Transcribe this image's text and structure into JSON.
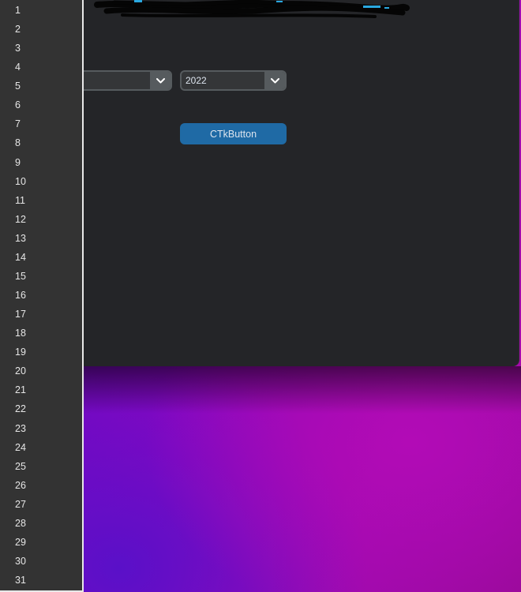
{
  "window": {
    "background_color": "#242528",
    "title_redacted": true
  },
  "comboboxes": [
    {
      "id": "combo-left",
      "value": "",
      "icon": "chevron-down-icon"
    },
    {
      "id": "combo-year",
      "value": "2022",
      "icon": "chevron-down-icon"
    }
  ],
  "button": {
    "label": "CTkButton",
    "color": "#1f6aa5"
  },
  "dropdown": {
    "options": [
      "1",
      "2",
      "3",
      "4",
      "5",
      "6",
      "7",
      "8",
      "9",
      "10",
      "11",
      "12",
      "13",
      "14",
      "15",
      "16",
      "17",
      "18",
      "19",
      "20",
      "21",
      "22",
      "23",
      "24",
      "25",
      "26",
      "27",
      "28",
      "29",
      "30",
      "31"
    ],
    "background_color": "#333333",
    "border_color": "#e8e8e8"
  },
  "wallpaper": {
    "colors": [
      "#5b0bc4",
      "#a00aaf"
    ]
  }
}
